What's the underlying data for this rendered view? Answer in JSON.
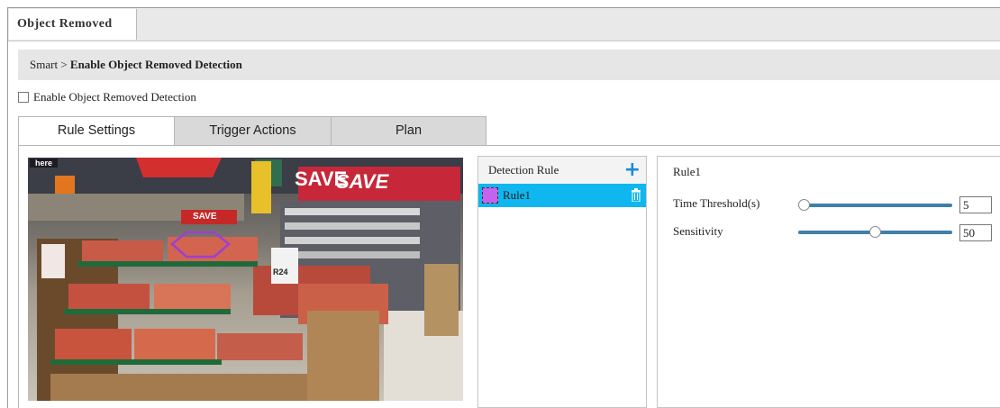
{
  "top_tab": {
    "label": "Object Removed"
  },
  "breadcrumb": {
    "root": "Smart",
    "separator": ">",
    "current": "Enable Object Removed Detection"
  },
  "enable_checkbox": {
    "label": "Enable Object Removed Detection",
    "checked": false
  },
  "tabs": [
    {
      "label": "Rule Settings",
      "active": true
    },
    {
      "label": "Trigger Actions",
      "active": false
    },
    {
      "label": "Plan",
      "active": false
    }
  ],
  "video": {
    "overlay_text": "here",
    "signs": [
      "SAVE",
      "SAVE",
      "SAVE",
      "R24"
    ]
  },
  "detection_rule": {
    "header": "Detection Rule",
    "add_icon": "plus-icon",
    "rules": [
      {
        "label": "Rule1",
        "color": "#c464ee",
        "selected": true
      }
    ],
    "delete_icon": "trash-icon"
  },
  "rule_detail": {
    "title": "Rule1",
    "time_threshold": {
      "label": "Time Threshold(s)",
      "value": "5",
      "level": 0.0
    },
    "sensitivity": {
      "label": "Sensitivity",
      "value": "50",
      "level": 0.5
    }
  },
  "colors": {
    "accent": "#10b7ef",
    "plus": "#1a8ad6",
    "slider": "#3f7fa8",
    "polygon": "#9b40d4"
  }
}
